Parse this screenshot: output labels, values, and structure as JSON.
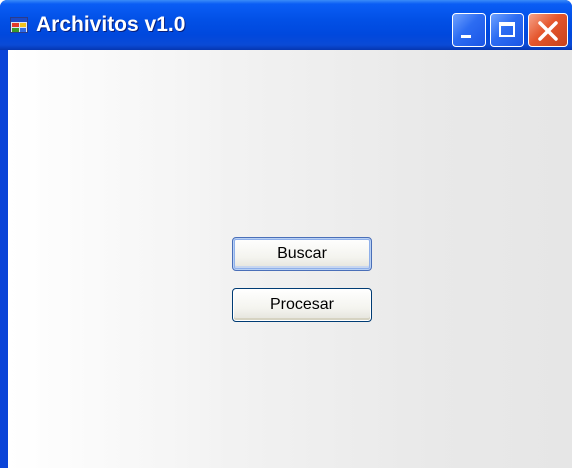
{
  "window": {
    "title": "Archivitos v1.0",
    "icon": "app-window-icon",
    "controls": {
      "minimize": "minimize-icon",
      "maximize": "maximize-icon",
      "close": "close-icon"
    }
  },
  "buttons": {
    "buscar": "Buscar",
    "procesar": "Procesar"
  },
  "colors": {
    "titlebar": "#0250e6",
    "close_button": "#e5562c",
    "client_background": "#ececec"
  }
}
